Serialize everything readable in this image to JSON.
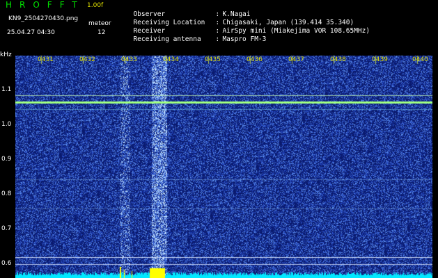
{
  "header": {
    "app_title": "HROFFT",
    "version": "1.00f",
    "filename": "KN9_2504270430.png",
    "timestamp": "25.04.27 04:30",
    "meteor_label": "meteor",
    "meteor_count": "12"
  },
  "info": [
    {
      "label": "Observer",
      "value": "K.Nagai"
    },
    {
      "label": "Receiving Location",
      "value": "Chigasaki, Japan (139.414 35.340)"
    },
    {
      "label": "Receiver",
      "value": "AirSpy mini (Miakejima VOR 108.65MHz)"
    },
    {
      "label": "Receiving antenna",
      "value": "Maspro FM-3"
    }
  ],
  "plot": {
    "y_unit": "kHz",
    "y_ticks": [
      "1.1",
      "1.0",
      "0.9",
      "0.8",
      "0.7",
      "0.6"
    ],
    "x_ticks": [
      "0431",
      "0432",
      "0433",
      "0434",
      "0435",
      "0436",
      "0437",
      "0438",
      "0439",
      "0440"
    ],
    "colors": {
      "background": "#0a1a6e",
      "noise": "#3a5fd0",
      "carrier": "#a0ff80",
      "bottom_band": "#00e8ff",
      "burst": "#ffff00"
    }
  }
}
